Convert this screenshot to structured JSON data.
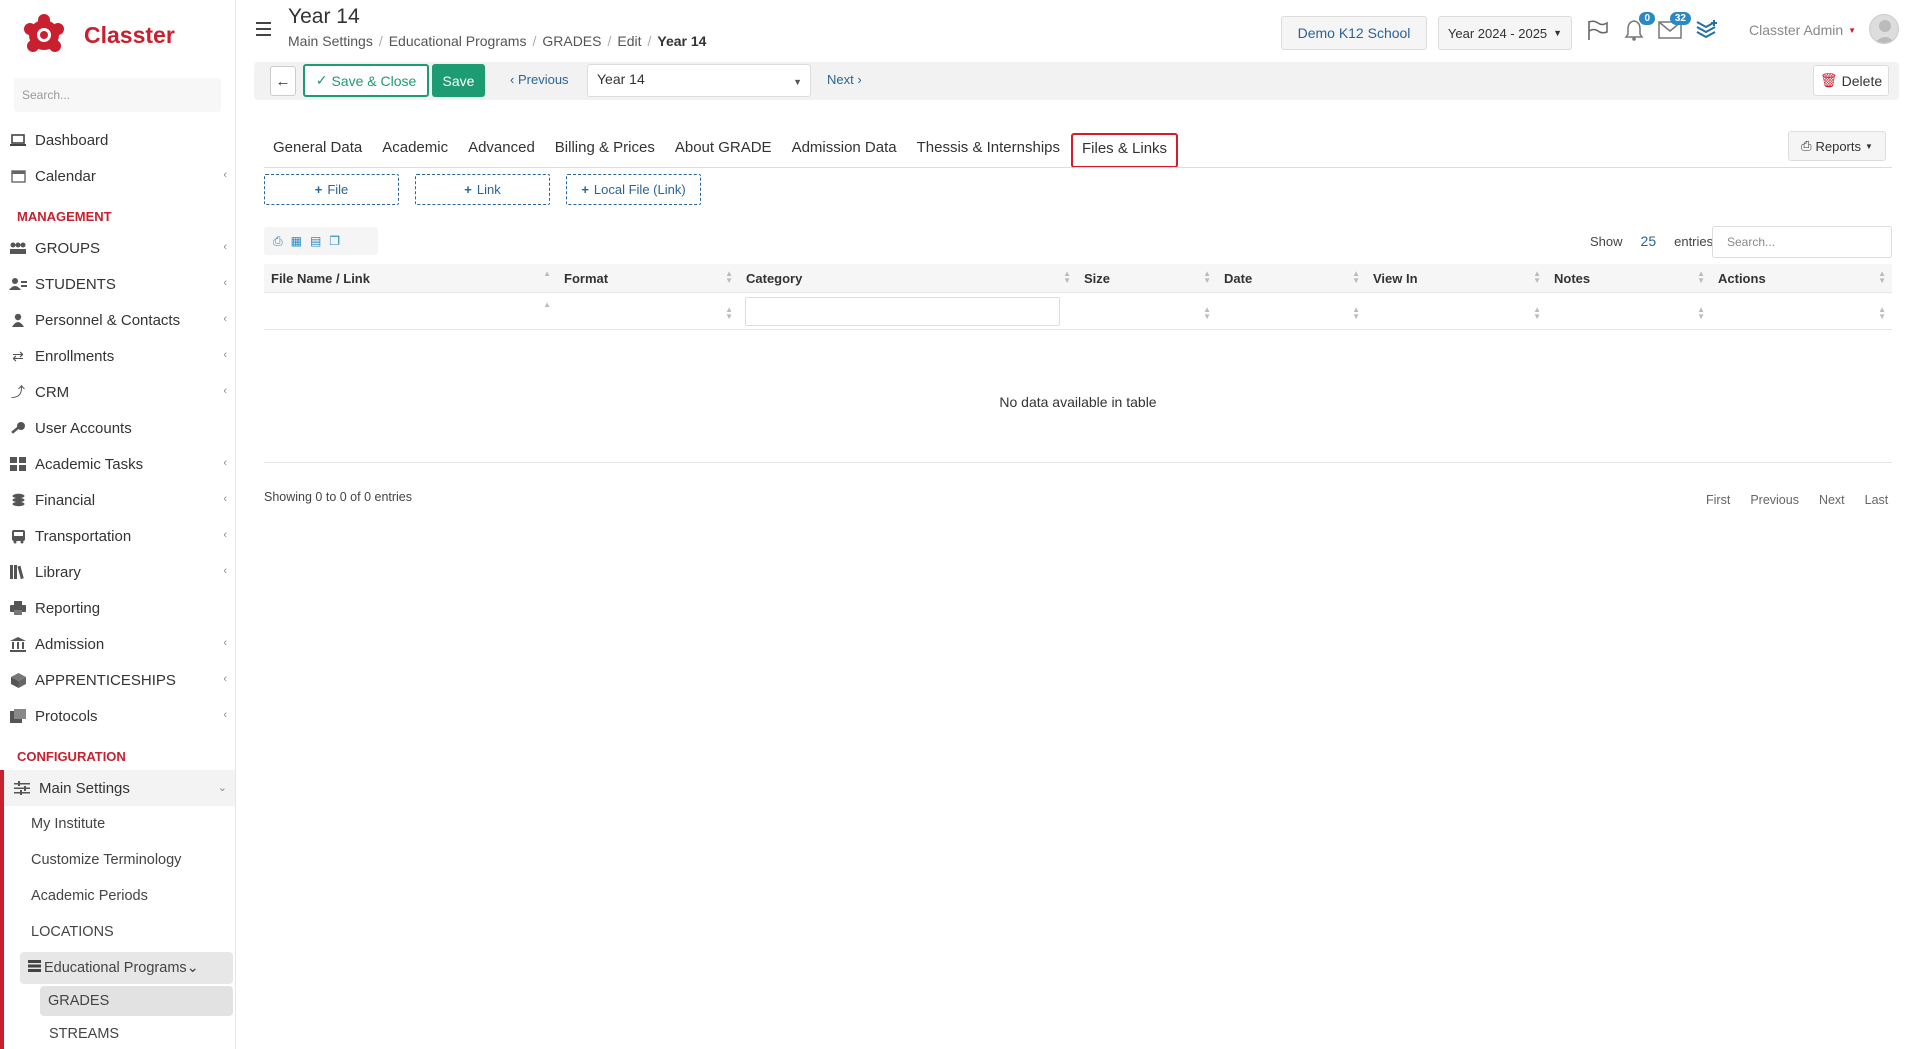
{
  "app": {
    "name": "Classter"
  },
  "sidebar": {
    "search_placeholder": "Search...",
    "top_items": [
      {
        "label": "Dashboard",
        "icon": "laptop-icon"
      },
      {
        "label": "Calendar",
        "icon": "calendar-icon"
      }
    ],
    "management_title": "MANAGEMENT",
    "management_items": [
      {
        "label": "GROUPS",
        "icon": "groups-icon"
      },
      {
        "label": "STUDENTS",
        "icon": "students-icon"
      },
      {
        "label": "Personnel & Contacts",
        "icon": "person-icon"
      },
      {
        "label": "Enrollments",
        "icon": "exchange-icon"
      },
      {
        "label": "CRM",
        "icon": "crm-icon"
      },
      {
        "label": "User Accounts",
        "icon": "key-icon"
      },
      {
        "label": "Academic Tasks",
        "icon": "grid-icon"
      },
      {
        "label": "Financial",
        "icon": "coins-icon"
      },
      {
        "label": "Transportation",
        "icon": "bus-icon"
      },
      {
        "label": "Library",
        "icon": "books-icon"
      },
      {
        "label": "Reporting",
        "icon": "printer-icon"
      },
      {
        "label": "Admission",
        "icon": "institution-icon"
      },
      {
        "label": "APPRENTICESHIPS",
        "icon": "cube-icon"
      },
      {
        "label": "Protocols",
        "icon": "protocols-icon"
      }
    ],
    "config_title": "CONFIGURATION",
    "config_items": {
      "main_settings": "Main Settings",
      "my_institute": "My Institute",
      "customize_terminology": "Customize Terminology",
      "academic_periods": "Academic Periods",
      "locations": "LOCATIONS",
      "educational_programs": "Educational Programs",
      "grades": "GRADES",
      "streams": "STREAMS"
    }
  },
  "header": {
    "title": "Year 14",
    "breadcrumb": [
      "Main Settings",
      "Educational Programs",
      "GRADES",
      "Edit",
      "Year 14"
    ],
    "school": "Demo K12 School",
    "year": "Year 2024 - 2025",
    "notifications_count": "0",
    "messages_count": "32",
    "user": "Classter Admin"
  },
  "toolbar": {
    "save_close": "Save & Close",
    "save": "Save",
    "previous": "Previous",
    "record": "Year 14",
    "next": "Next",
    "delete": "Delete"
  },
  "tabs": [
    "General Data",
    "Academic",
    "Advanced",
    "Billing & Prices",
    "About GRADE",
    "Admission Data",
    "Thessis & Internships",
    "Files & Links"
  ],
  "active_tab": "Files & Links",
  "reports": "Reports",
  "add_buttons": {
    "file": "File",
    "link": "Link",
    "local_file": "Local File (Link)"
  },
  "table": {
    "show_label": "Show",
    "entries_count": "25",
    "entries_label": "entries",
    "search_placeholder": "Search...",
    "columns": [
      "File Name / Link",
      "Format",
      "Category",
      "Size",
      "Date",
      "View In",
      "Notes",
      "Actions"
    ],
    "empty_message": "No data available in table",
    "showing": "Showing 0 to 0 of 0 entries",
    "pager": [
      "First",
      "Previous",
      "Next",
      "Last"
    ]
  },
  "colors": {
    "brand_red": "#c8202f",
    "accent_green": "#1d9b72",
    "link_blue": "#2a6496",
    "badge_blue": "#2a88c5"
  }
}
